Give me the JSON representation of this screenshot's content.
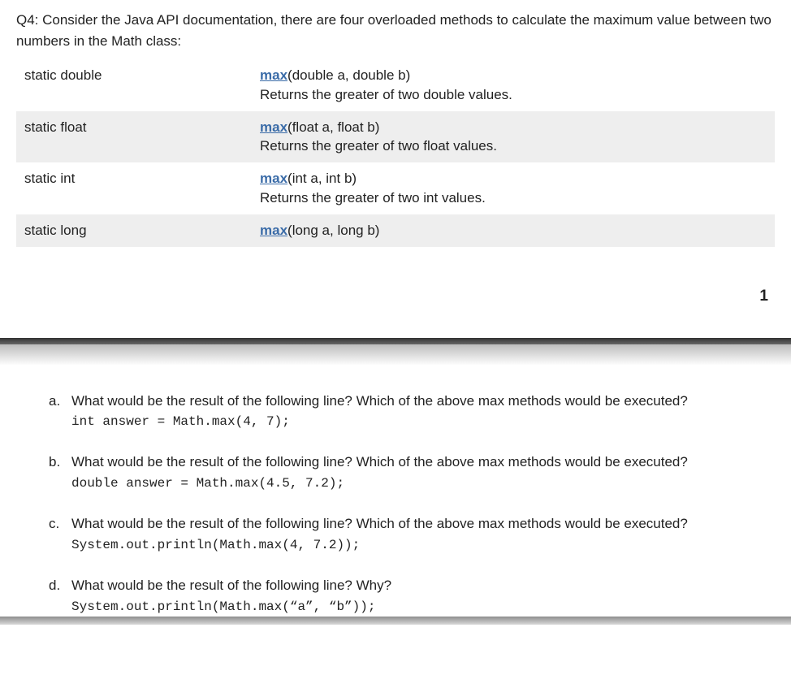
{
  "question": {
    "heading": "Q4: Consider the Java API documentation, there are four overloaded methods to calculate the maximum value between two numbers in the Math class:"
  },
  "api_rows": [
    {
      "ret": "static double",
      "method": "max",
      "params": "(double a, double b)",
      "desc": "Returns the greater of two double values."
    },
    {
      "ret": "static float",
      "method": "max",
      "params": "(float a, float b)",
      "desc": "Returns the greater of two float values."
    },
    {
      "ret": "static int",
      "method": "max",
      "params": "(int a, int b)",
      "desc": "Returns the greater of two int values."
    },
    {
      "ret": "static long",
      "method": "max",
      "params": "(long a, long b)",
      "desc": ""
    }
  ],
  "page_number": "1",
  "subquestions": [
    {
      "marker": "a.",
      "text": "What would be the result of the following line? Which of the above max methods would be executed?",
      "code": "int answer = Math.max(4, 7);"
    },
    {
      "marker": "b.",
      "text": "What would be the result of the following line? Which of the above max methods would be executed?",
      "code": "double answer = Math.max(4.5, 7.2);"
    },
    {
      "marker": "c.",
      "text": "What would be the result of the following line? Which of the above max methods would be executed?",
      "code": "System.out.println(Math.max(4, 7.2));"
    },
    {
      "marker": "d.",
      "text": "What would be the result of the following line? Why?",
      "code": "System.out.println(Math.max(“a”, “b”));"
    }
  ]
}
